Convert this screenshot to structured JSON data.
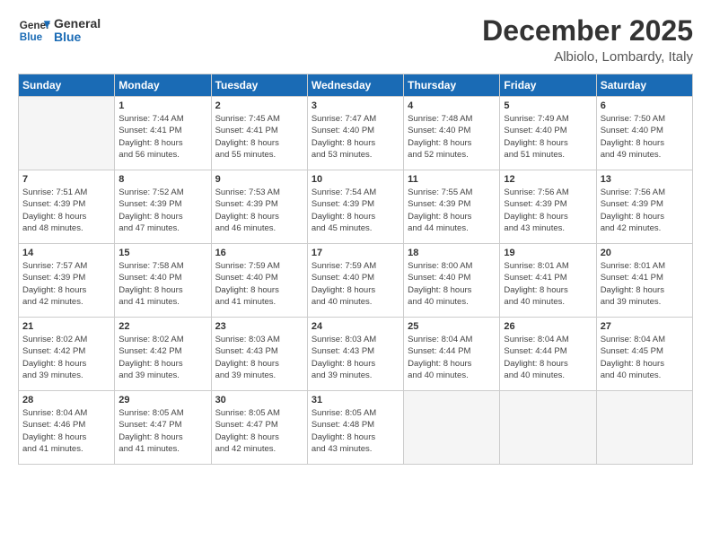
{
  "header": {
    "logo_line1": "General",
    "logo_line2": "Blue",
    "month": "December 2025",
    "location": "Albiolo, Lombardy, Italy"
  },
  "weekdays": [
    "Sunday",
    "Monday",
    "Tuesday",
    "Wednesday",
    "Thursday",
    "Friday",
    "Saturday"
  ],
  "weeks": [
    [
      {
        "day": "",
        "info": ""
      },
      {
        "day": "1",
        "info": "Sunrise: 7:44 AM\nSunset: 4:41 PM\nDaylight: 8 hours\nand 56 minutes."
      },
      {
        "day": "2",
        "info": "Sunrise: 7:45 AM\nSunset: 4:41 PM\nDaylight: 8 hours\nand 55 minutes."
      },
      {
        "day": "3",
        "info": "Sunrise: 7:47 AM\nSunset: 4:40 PM\nDaylight: 8 hours\nand 53 minutes."
      },
      {
        "day": "4",
        "info": "Sunrise: 7:48 AM\nSunset: 4:40 PM\nDaylight: 8 hours\nand 52 minutes."
      },
      {
        "day": "5",
        "info": "Sunrise: 7:49 AM\nSunset: 4:40 PM\nDaylight: 8 hours\nand 51 minutes."
      },
      {
        "day": "6",
        "info": "Sunrise: 7:50 AM\nSunset: 4:40 PM\nDaylight: 8 hours\nand 49 minutes."
      }
    ],
    [
      {
        "day": "7",
        "info": "Sunrise: 7:51 AM\nSunset: 4:39 PM\nDaylight: 8 hours\nand 48 minutes."
      },
      {
        "day": "8",
        "info": "Sunrise: 7:52 AM\nSunset: 4:39 PM\nDaylight: 8 hours\nand 47 minutes."
      },
      {
        "day": "9",
        "info": "Sunrise: 7:53 AM\nSunset: 4:39 PM\nDaylight: 8 hours\nand 46 minutes."
      },
      {
        "day": "10",
        "info": "Sunrise: 7:54 AM\nSunset: 4:39 PM\nDaylight: 8 hours\nand 45 minutes."
      },
      {
        "day": "11",
        "info": "Sunrise: 7:55 AM\nSunset: 4:39 PM\nDaylight: 8 hours\nand 44 minutes."
      },
      {
        "day": "12",
        "info": "Sunrise: 7:56 AM\nSunset: 4:39 PM\nDaylight: 8 hours\nand 43 minutes."
      },
      {
        "day": "13",
        "info": "Sunrise: 7:56 AM\nSunset: 4:39 PM\nDaylight: 8 hours\nand 42 minutes."
      }
    ],
    [
      {
        "day": "14",
        "info": "Sunrise: 7:57 AM\nSunset: 4:39 PM\nDaylight: 8 hours\nand 42 minutes."
      },
      {
        "day": "15",
        "info": "Sunrise: 7:58 AM\nSunset: 4:40 PM\nDaylight: 8 hours\nand 41 minutes."
      },
      {
        "day": "16",
        "info": "Sunrise: 7:59 AM\nSunset: 4:40 PM\nDaylight: 8 hours\nand 41 minutes."
      },
      {
        "day": "17",
        "info": "Sunrise: 7:59 AM\nSunset: 4:40 PM\nDaylight: 8 hours\nand 40 minutes."
      },
      {
        "day": "18",
        "info": "Sunrise: 8:00 AM\nSunset: 4:40 PM\nDaylight: 8 hours\nand 40 minutes."
      },
      {
        "day": "19",
        "info": "Sunrise: 8:01 AM\nSunset: 4:41 PM\nDaylight: 8 hours\nand 40 minutes."
      },
      {
        "day": "20",
        "info": "Sunrise: 8:01 AM\nSunset: 4:41 PM\nDaylight: 8 hours\nand 39 minutes."
      }
    ],
    [
      {
        "day": "21",
        "info": "Sunrise: 8:02 AM\nSunset: 4:42 PM\nDaylight: 8 hours\nand 39 minutes."
      },
      {
        "day": "22",
        "info": "Sunrise: 8:02 AM\nSunset: 4:42 PM\nDaylight: 8 hours\nand 39 minutes."
      },
      {
        "day": "23",
        "info": "Sunrise: 8:03 AM\nSunset: 4:43 PM\nDaylight: 8 hours\nand 39 minutes."
      },
      {
        "day": "24",
        "info": "Sunrise: 8:03 AM\nSunset: 4:43 PM\nDaylight: 8 hours\nand 39 minutes."
      },
      {
        "day": "25",
        "info": "Sunrise: 8:04 AM\nSunset: 4:44 PM\nDaylight: 8 hours\nand 40 minutes."
      },
      {
        "day": "26",
        "info": "Sunrise: 8:04 AM\nSunset: 4:44 PM\nDaylight: 8 hours\nand 40 minutes."
      },
      {
        "day": "27",
        "info": "Sunrise: 8:04 AM\nSunset: 4:45 PM\nDaylight: 8 hours\nand 40 minutes."
      }
    ],
    [
      {
        "day": "28",
        "info": "Sunrise: 8:04 AM\nSunset: 4:46 PM\nDaylight: 8 hours\nand 41 minutes."
      },
      {
        "day": "29",
        "info": "Sunrise: 8:05 AM\nSunset: 4:47 PM\nDaylight: 8 hours\nand 41 minutes."
      },
      {
        "day": "30",
        "info": "Sunrise: 8:05 AM\nSunset: 4:47 PM\nDaylight: 8 hours\nand 42 minutes."
      },
      {
        "day": "31",
        "info": "Sunrise: 8:05 AM\nSunset: 4:48 PM\nDaylight: 8 hours\nand 43 minutes."
      },
      {
        "day": "",
        "info": ""
      },
      {
        "day": "",
        "info": ""
      },
      {
        "day": "",
        "info": ""
      }
    ]
  ]
}
